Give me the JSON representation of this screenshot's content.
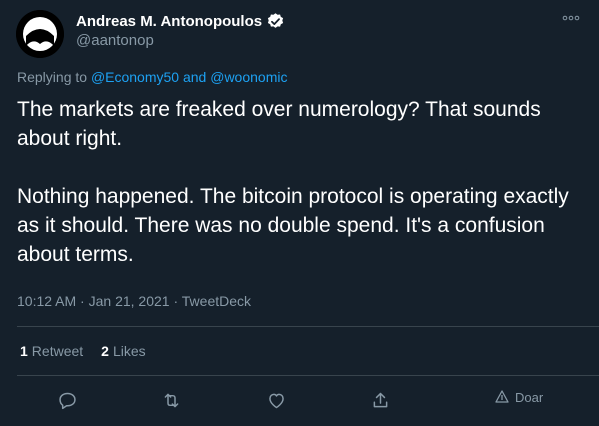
{
  "author": {
    "display_name": "Andreas M. Antonopoulos",
    "handle": "@aantonop",
    "verified": true
  },
  "reply": {
    "prefix": "Replying to",
    "user1": "@Economy50",
    "conjunction": "and",
    "user2": "@woonomic"
  },
  "tweet": {
    "paragraph1": "The markets are freaked over numerology? That sounds about right.",
    "paragraph2": "Nothing happened. The bitcoin protocol is operating exactly as it should. There was no double spend. It's a confusion about terms."
  },
  "meta": {
    "time": "10:12 AM",
    "separator": "·",
    "date": "Jan 21, 2021",
    "source": "TweetDeck"
  },
  "stats": {
    "retweets_count": "1",
    "retweets_label": "Retweet",
    "likes_count": "2",
    "likes_label": "Likes"
  },
  "actions": {
    "tip_label": "Doar"
  },
  "colors": {
    "background": "#15202b",
    "accent": "#1da1f2",
    "muted": "#8899a6",
    "divider": "#38444d"
  }
}
